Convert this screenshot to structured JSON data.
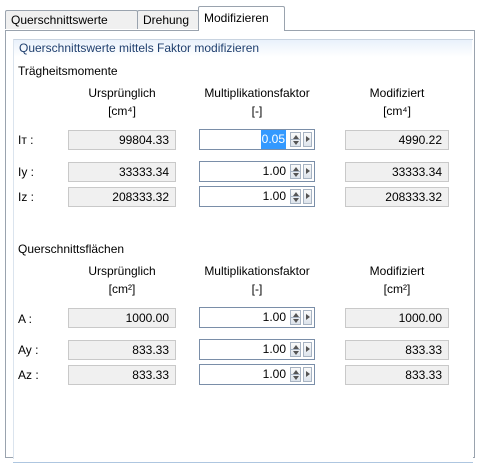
{
  "tabs": [
    {
      "label": "Querschnittswerte"
    },
    {
      "label": "Drehung"
    },
    {
      "label": "Modifizieren"
    }
  ],
  "group": {
    "title": "Querschnittswerte mittels Faktor modifizieren"
  },
  "traegheit": {
    "title": "Trägheitsmomente",
    "col_original": "Ursprünglich",
    "col_factor": "Multiplikationsfaktor",
    "col_modified": "Modifiziert",
    "unit_original": "[cm⁴]",
    "unit_factor": "[-]",
    "unit_modified": "[cm⁴]",
    "rows": [
      {
        "label": "Iᴛ :",
        "original": "99804.33",
        "factor": "0.05",
        "modified": "4990.22"
      },
      {
        "label": "Iy :",
        "original": "33333.34",
        "factor": "1.00",
        "modified": "33333.34"
      },
      {
        "label": "Iz :",
        "original": "208333.32",
        "factor": "1.00",
        "modified": "208333.32"
      }
    ]
  },
  "flaechen": {
    "title": "Querschnittsflächen",
    "col_original": "Ursprünglich",
    "col_factor": "Multiplikationsfaktor",
    "col_modified": "Modifiziert",
    "unit_original": "[cm²]",
    "unit_factor": "[-]",
    "unit_modified": "[cm²]",
    "rows": [
      {
        "label": "A :",
        "original": "1000.00",
        "factor": "1.00",
        "modified": "1000.00"
      },
      {
        "label": "Ay :",
        "original": "833.33",
        "factor": "1.00",
        "modified": "833.33"
      },
      {
        "label": "Az :",
        "original": "833.33",
        "factor": "1.00",
        "modified": "833.33"
      }
    ]
  }
}
